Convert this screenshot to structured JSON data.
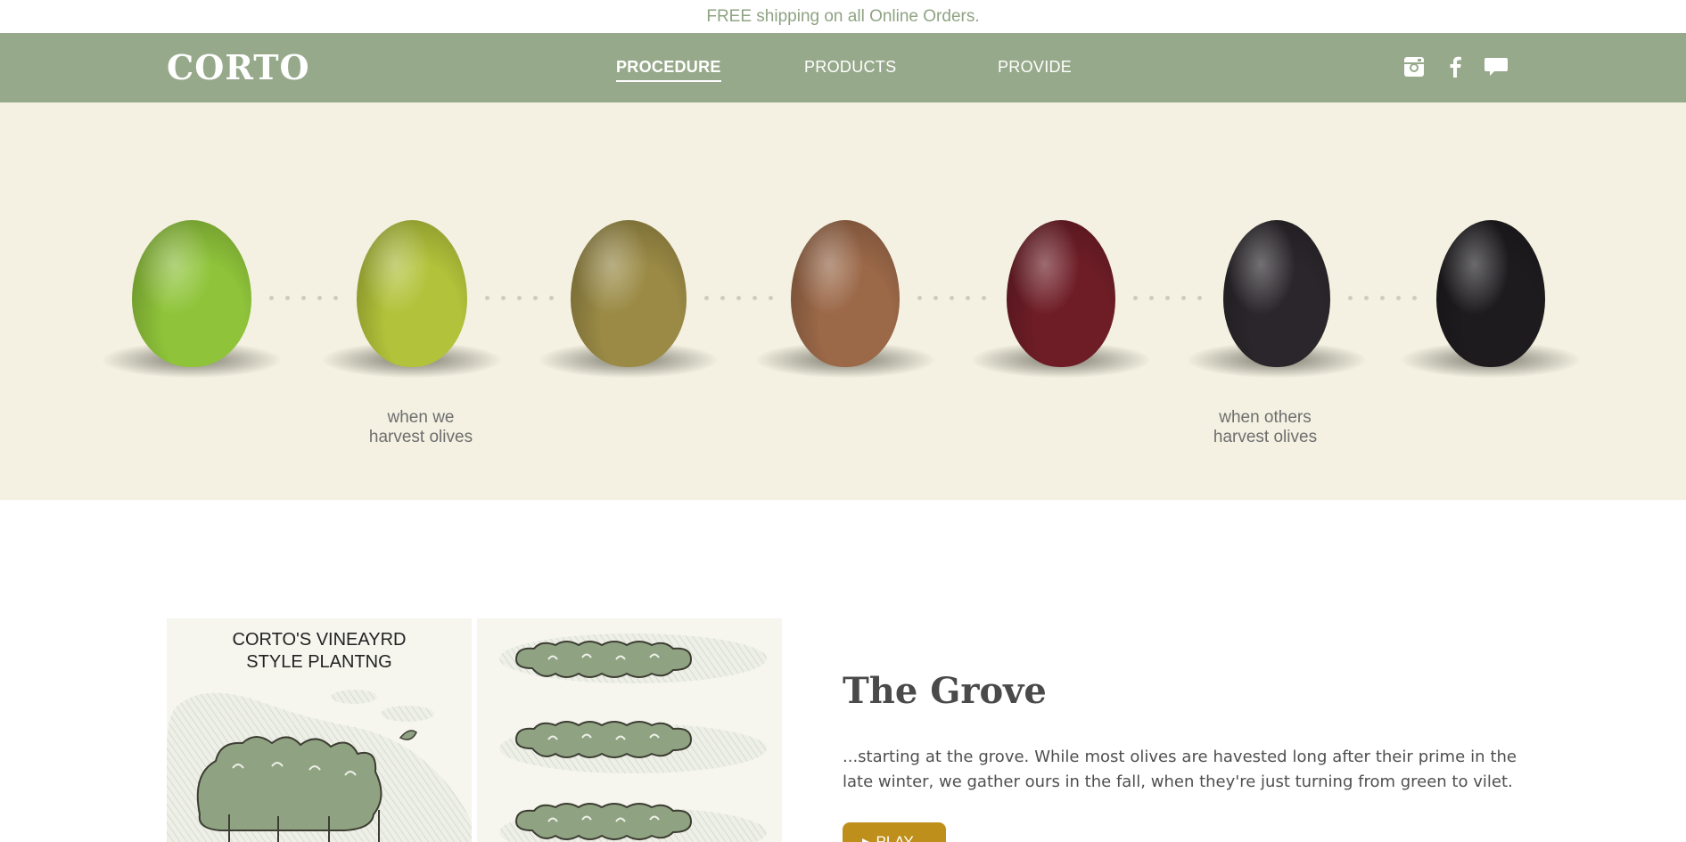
{
  "promo": {
    "text": "FREE shipping on all Online Orders."
  },
  "header": {
    "logo": "CORTO",
    "nav": [
      {
        "label": "PROCEDURE",
        "active": true
      },
      {
        "label": "PRODUCTS",
        "active": false
      },
      {
        "label": "PROVIDE",
        "active": false
      }
    ],
    "social_icons": [
      "instagram-icon",
      "facebook-icon",
      "chat-icon"
    ]
  },
  "hero": {
    "olives": [
      {
        "stage": 1,
        "color": "#8fc43a"
      },
      {
        "stage": 2,
        "color": "#b2c23a"
      },
      {
        "stage": 3,
        "color": "#9a8a45"
      },
      {
        "stage": 4,
        "color": "#9b6848"
      },
      {
        "stage": 5,
        "color": "#6e1d26"
      },
      {
        "stage": 6,
        "color": "#2a262b"
      },
      {
        "stage": 7,
        "color": "#1d1b1e"
      }
    ],
    "caption_left": [
      "when we",
      "harvest olives"
    ],
    "caption_right": [
      "when others",
      "harvest olives"
    ]
  },
  "grove": {
    "image_title": [
      "CORTO'S VINEAYRD",
      "STYLE PLANTNG"
    ],
    "title": "The Grove",
    "text": "...starting at the grove. While most olives are havested long after their prime in the late winter, we gather ours in the fall, when they're just turning from green to vilet.",
    "play_label": "PLAY"
  },
  "colors": {
    "nav_bg": "#97a98b",
    "hero_bg": "#f4f1e2",
    "promo_text": "#8fa383",
    "button": "#bf8f1b",
    "tree_green": "#8fa383"
  }
}
